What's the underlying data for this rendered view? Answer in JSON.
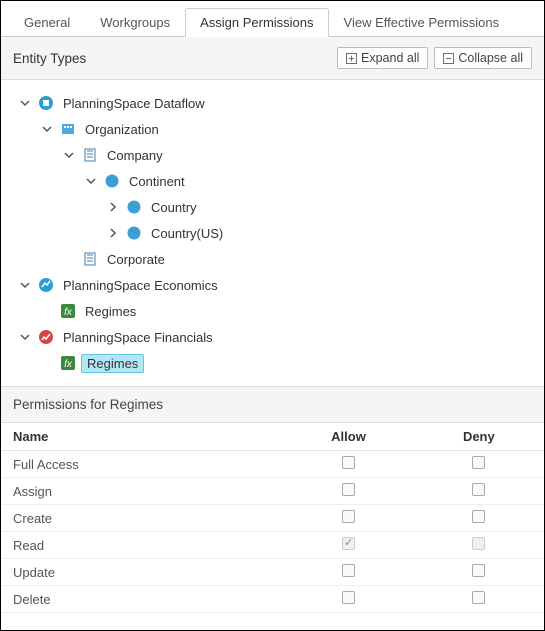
{
  "tabs": [
    {
      "label": "General",
      "active": false
    },
    {
      "label": "Workgroups",
      "active": false
    },
    {
      "label": "Assign Permissions",
      "active": true
    },
    {
      "label": "View Effective Permissions",
      "active": false
    }
  ],
  "entity_section": {
    "title": "Entity Types",
    "expand_all": "Expand all",
    "collapse_all": "Collapse all"
  },
  "tree": {
    "n0": {
      "label": "PlanningSpace Dataflow"
    },
    "n1": {
      "label": "Organization"
    },
    "n2": {
      "label": "Company"
    },
    "n3": {
      "label": "Continent"
    },
    "n4": {
      "label": "Country"
    },
    "n5": {
      "label": "Country(US)"
    },
    "n6": {
      "label": "Corporate"
    },
    "n7": {
      "label": "PlanningSpace Economics"
    },
    "n8": {
      "label": "Regimes"
    },
    "n9": {
      "label": "PlanningSpace Financials"
    },
    "n10": {
      "label": "Regimes"
    }
  },
  "perm_section": {
    "title": "Permissions for Regimes",
    "cols": {
      "name": "Name",
      "allow": "Allow",
      "deny": "Deny"
    },
    "rows": [
      {
        "name": "Full Access",
        "allow": false,
        "deny": false,
        "allow_disabled": false,
        "deny_disabled": false
      },
      {
        "name": "Assign",
        "allow": false,
        "deny": false,
        "allow_disabled": false,
        "deny_disabled": false
      },
      {
        "name": "Create",
        "allow": false,
        "deny": false,
        "allow_disabled": false,
        "deny_disabled": false
      },
      {
        "name": "Read",
        "allow": true,
        "deny": false,
        "allow_disabled": true,
        "deny_disabled": true
      },
      {
        "name": "Update",
        "allow": false,
        "deny": false,
        "allow_disabled": false,
        "deny_disabled": false
      },
      {
        "name": "Delete",
        "allow": false,
        "deny": false,
        "allow_disabled": false,
        "deny_disabled": false
      }
    ]
  }
}
